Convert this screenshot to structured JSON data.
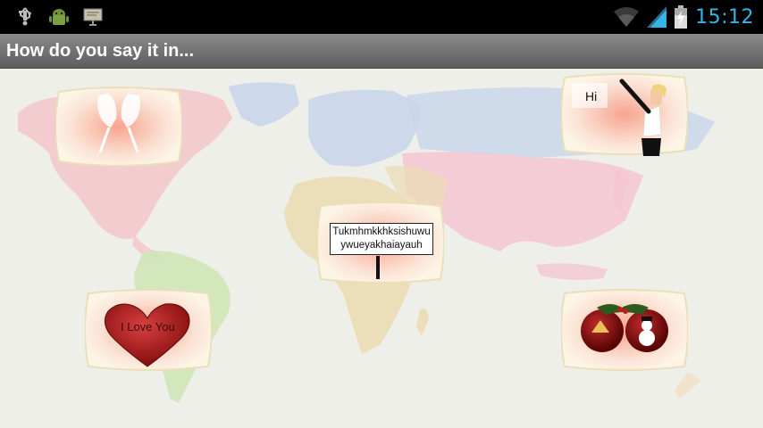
{
  "status_bar": {
    "time": "15:12",
    "left_icons": [
      "usb-icon",
      "android-debug-icon",
      "screen-cast-icon"
    ],
    "right_icons": [
      "wifi-icon",
      "signal-icon",
      "battery-charging-icon"
    ],
    "clock_color": "#33b5e5"
  },
  "app": {
    "title": "How do you say it in..."
  },
  "tiles": [
    {
      "id": "cheers",
      "icon": "champagne-glasses-icon"
    },
    {
      "id": "hello",
      "icon": "waving-woman-icon",
      "text": "Hi"
    },
    {
      "id": "name",
      "icon": "sign-icon",
      "text": "Tukmhmkkhksishuwuywueyakhaiayauh"
    },
    {
      "id": "love",
      "icon": "heart-icon",
      "text": "I Love You"
    },
    {
      "id": "christmas",
      "icon": "christmas-ornaments-icon"
    }
  ],
  "colors": {
    "map_background": "#efefe9",
    "heart": "#a81d1d",
    "ornament": "#8b1212",
    "action_bar": "#6f6f6f"
  }
}
